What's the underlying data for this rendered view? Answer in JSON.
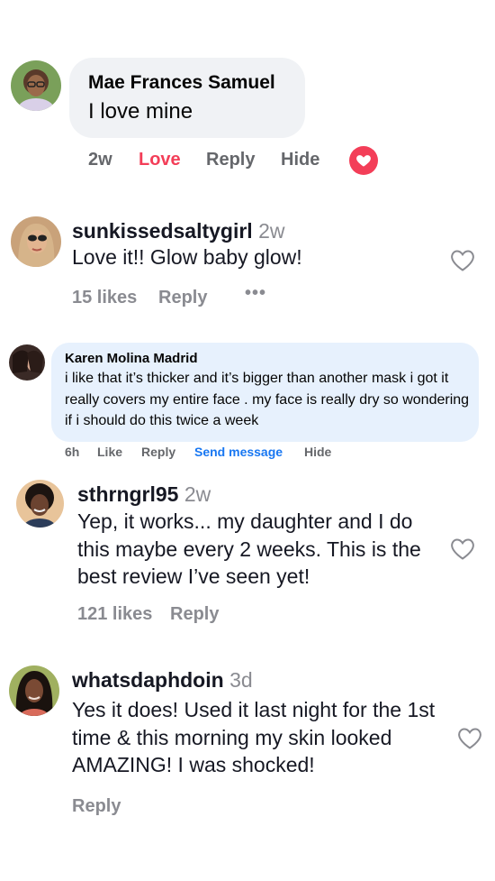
{
  "comment1": {
    "author": "Mae Frances Samuel",
    "text": "I love mine",
    "time": "2w",
    "reaction_label": "Love",
    "reply_label": "Reply",
    "hide_label": "Hide",
    "reaction_icon": "love-reaction-icon",
    "accent_color": "#f33e58"
  },
  "comment2": {
    "author": "sunkissedsaltygirl",
    "time": "2w",
    "text": "Love it!! Glow baby glow!",
    "likes": "15 likes",
    "reply_label": "Reply",
    "more_icon": "more-icon"
  },
  "comment3": {
    "author": "Karen Molina Madrid",
    "text": "i like that it’s thicker and it’s bigger than another mask i got it really covers my entire face . my face is really dry so wondering if i should do this twice a week",
    "time": "6h",
    "like_label": "Like",
    "reply_label": "Reply",
    "send_label": "Send message",
    "hide_label": "Hide",
    "send_color": "#1877f2"
  },
  "comment4": {
    "author": "sthrngrl95",
    "time": "2w",
    "text": "Yep, it works... my daughter and I do this maybe every 2 weeks. This is the best review I’ve seen yet!",
    "likes": "121 likes",
    "reply_label": "Reply"
  },
  "comment5": {
    "author": "whatsdaphdoin",
    "time": "3d",
    "text": "Yes it does! Used it last night for the 1st time & this morning my skin looked AMAZING! I was shocked!",
    "reply_label": "Reply"
  }
}
